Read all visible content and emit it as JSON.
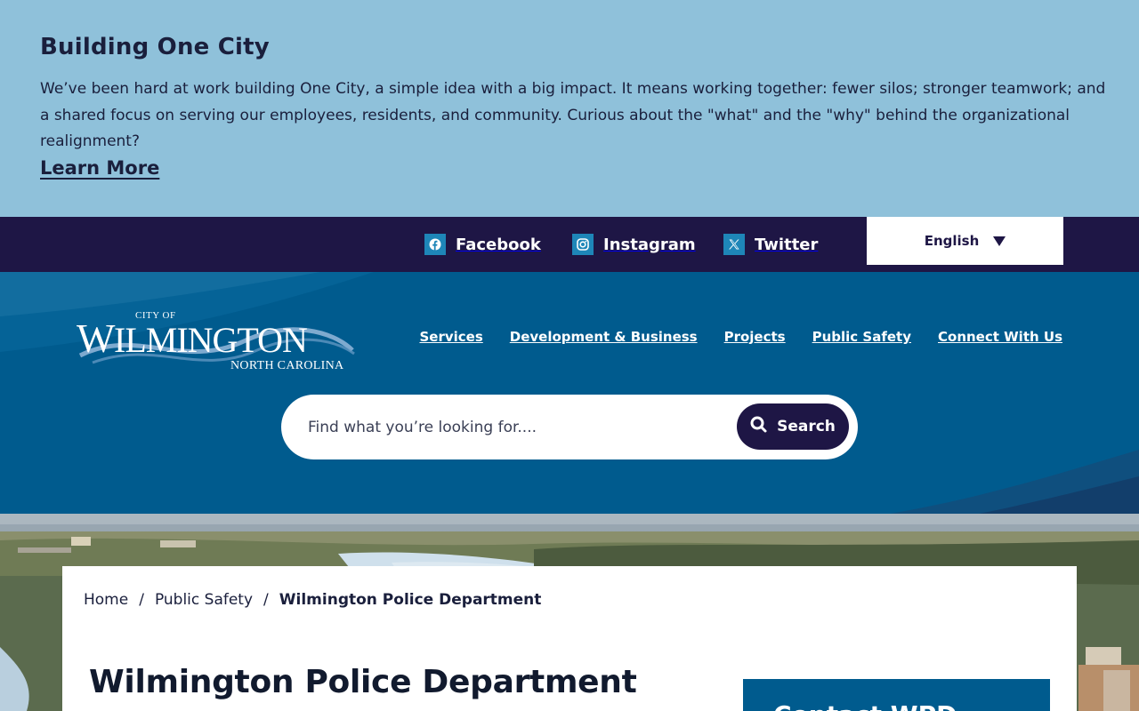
{
  "alert": {
    "title": "Building One City",
    "body": "We’ve been hard at work building One City, a simple idea with a big impact. It means working together: fewer silos; stronger teamwork; and a shared focus on serving our employees, residents, and community. Curious about the \"what\" and the \"why\" behind the organizational realignment?",
    "link": "Learn More"
  },
  "utility": {
    "social": [
      {
        "label": "Facebook",
        "icon": "facebook-icon"
      },
      {
        "label": "Instagram",
        "icon": "instagram-icon"
      },
      {
        "label": "Twitter",
        "icon": "x-twitter-icon"
      }
    ],
    "language": "English"
  },
  "header": {
    "logo": {
      "top": "CITY OF",
      "main": "WILMINGTON",
      "sub": "NORTH CAROLINA"
    },
    "nav": [
      "Services",
      "Development & Business",
      "Projects",
      "Public Safety",
      "Connect With Us"
    ],
    "search": {
      "placeholder": "Find what you’re looking for....",
      "button": "Search"
    }
  },
  "breadcrumb": {
    "items": [
      "Home",
      "Public Safety"
    ],
    "current": "Wilmington Police Department"
  },
  "page": {
    "title": "Wilmington Police Department"
  },
  "sidebar": {
    "contact_title": "Contact WPD"
  },
  "colors": {
    "alert_bg": "#8fc1da",
    "utility_bg": "#1e1645",
    "header_bg": "#005b8e",
    "accent": "#1e86b8"
  }
}
